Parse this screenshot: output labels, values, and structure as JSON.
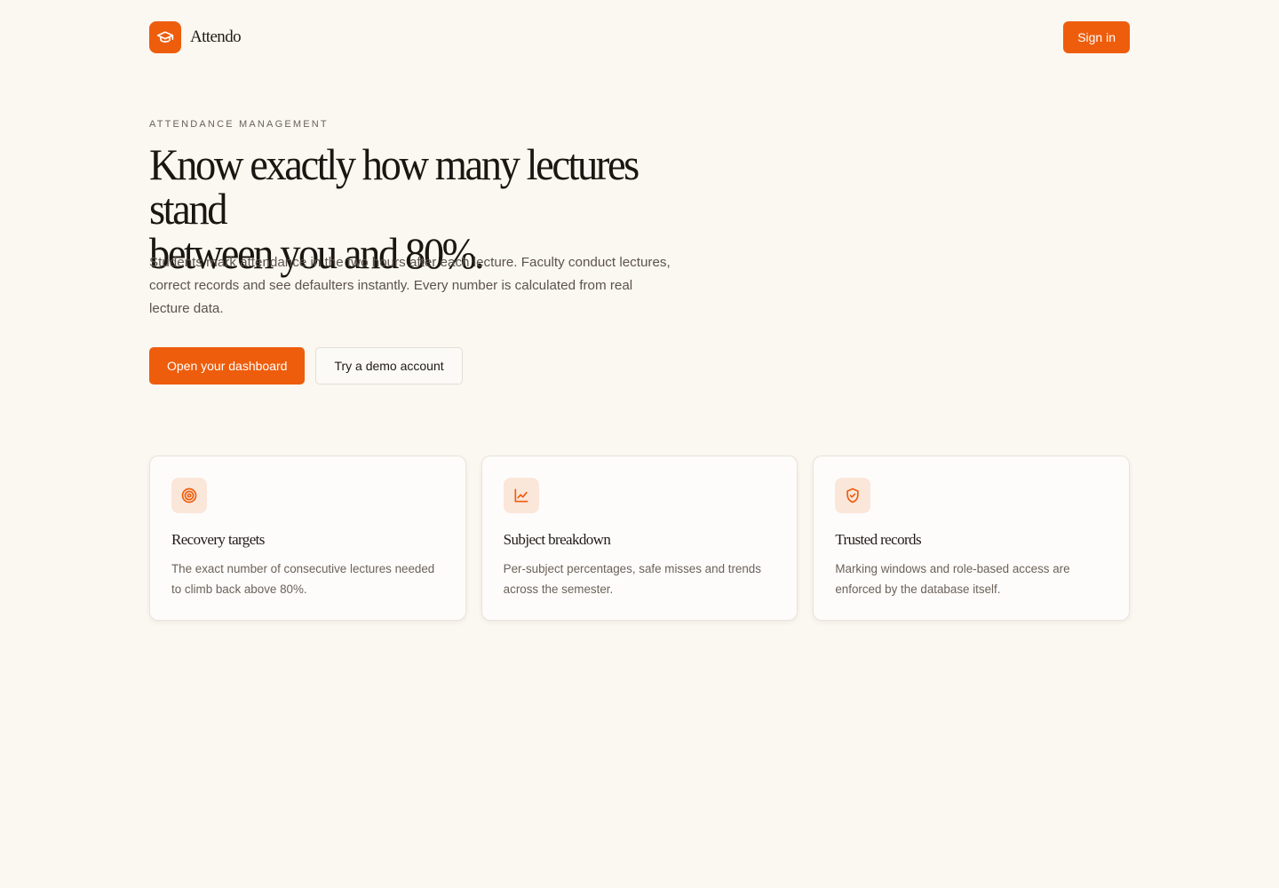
{
  "header": {
    "brand_name": "Attendo",
    "signin_label": "Sign in"
  },
  "hero": {
    "eyebrow": "ATTENDANCE MANAGEMENT",
    "headline_line1": "Know exactly how many lectures stand",
    "headline_line2": "between you and 80%.",
    "lede": "Students mark attendance in the two hours after each lecture. Faculty conduct lectures, correct records and see defaulters instantly. Every number is calculated from real lecture data.",
    "primary_cta": "Open your dashboard",
    "secondary_cta": "Try a demo account"
  },
  "features": [
    {
      "icon": "target-icon",
      "title": "Recovery targets",
      "text": "The exact number of consecutive lectures needed to climb back above 80%."
    },
    {
      "icon": "line-chart-icon",
      "title": "Subject breakdown",
      "text": "Per-subject percentages, safe misses and trends across the semester."
    },
    {
      "icon": "shield-check-icon",
      "title": "Trusted records",
      "text": "Marking windows and role-based access are enforced by the database itself."
    }
  ],
  "colors": {
    "accent": "#ee5d0c",
    "background": "#fbf7f1",
    "icon_tile": "#fbe6da"
  }
}
